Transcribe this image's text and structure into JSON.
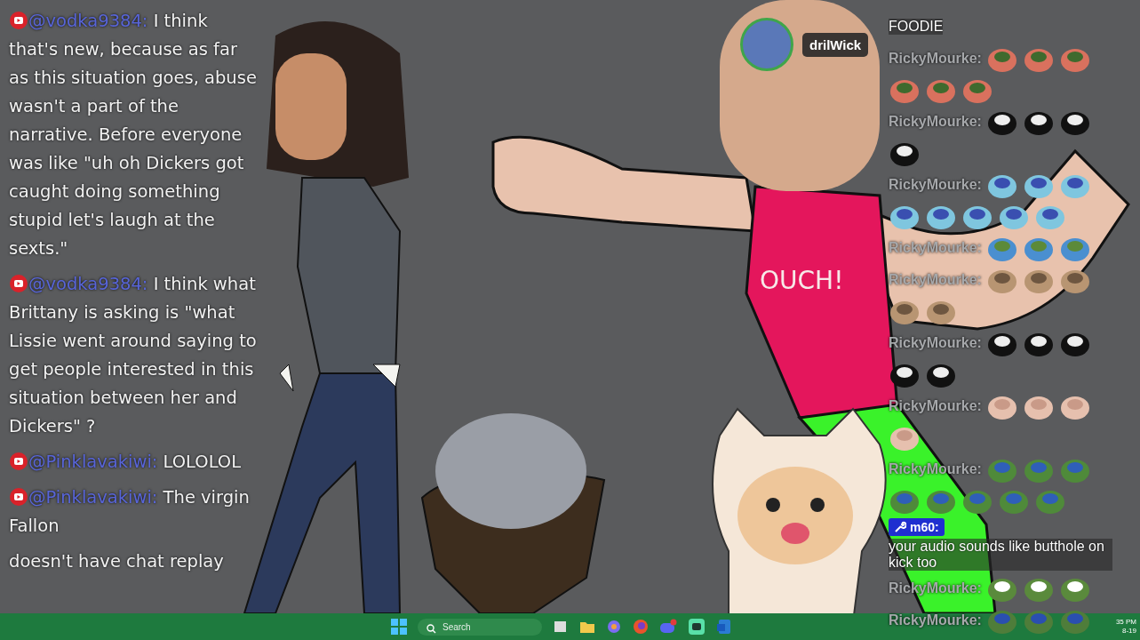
{
  "left_chat": [
    {
      "kind": "message",
      "user": "@vodka9384:",
      "text": "I think that's new, because as far as this situation goes, abuse wasn't a part of the narrative. Before everyone was like \"uh oh Dickers got caught doing something stupid let's laugh at the sexts.\""
    },
    {
      "kind": "message",
      "user": "@vodka9384:",
      "text": "I think what Brittany is asking is \"what Lissie went around saying to get people interested in this situation between her and Dickers\" ?"
    },
    {
      "kind": "message",
      "user": "@Pinklavakiwi:",
      "text": "LOLOLOL"
    },
    {
      "kind": "message",
      "user": "@Pinklavakiwi:",
      "text": "The virgin Fallon"
    },
    {
      "kind": "continuation",
      "text": "doesn't have chat replay"
    }
  ],
  "scene": {
    "shirt_text": "OUCH!",
    "speaker": {
      "name": "drilWick"
    }
  },
  "right_chat": [
    {
      "kind": "continuation",
      "text": "FOODIE"
    },
    {
      "kind": "emotes",
      "user": "RickyMourke:",
      "emotes": [
        {
          "kind": "blanket-frog"
        },
        {
          "kind": "blanket-frog"
        },
        {
          "kind": "blanket-frog"
        },
        {
          "kind": "blanket-frog"
        },
        {
          "kind": "blanket-frog"
        },
        {
          "kind": "blanket-frog"
        }
      ]
    },
    {
      "kind": "emotes",
      "user": "RickyMourke:",
      "emotes": [
        {
          "kind": "cow"
        },
        {
          "kind": "cow"
        },
        {
          "kind": "cow"
        },
        {
          "kind": "cow"
        }
      ]
    },
    {
      "kind": "emotes",
      "user": "RickyMourke:",
      "emotes": [
        {
          "kind": "shout-face"
        },
        {
          "kind": "shout-face"
        },
        {
          "kind": "shout-face"
        },
        {
          "kind": "shout-face"
        },
        {
          "kind": "shout-face"
        },
        {
          "kind": "shout-face"
        },
        {
          "kind": "shout-face"
        },
        {
          "kind": "shout-face"
        }
      ]
    },
    {
      "kind": "emotes",
      "user": "RickyMourke:",
      "emotes": [
        {
          "kind": "wave-frog"
        },
        {
          "kind": "wave-frog"
        },
        {
          "kind": "wave-frog"
        }
      ]
    },
    {
      "kind": "emotes",
      "user": "RickyMourke:",
      "emotes": [
        {
          "kind": "cat"
        },
        {
          "kind": "cat"
        },
        {
          "kind": "cat"
        },
        {
          "kind": "cat"
        },
        {
          "kind": "cat"
        }
      ]
    },
    {
      "kind": "emotes",
      "user": "RickyMourke:",
      "emotes": [
        {
          "kind": "cow"
        },
        {
          "kind": "cow"
        },
        {
          "kind": "cow"
        },
        {
          "kind": "cow"
        },
        {
          "kind": "cow"
        }
      ]
    },
    {
      "kind": "emotes",
      "user": "RickyMourke:",
      "emotes": [
        {
          "kind": "fist"
        },
        {
          "kind": "fist"
        },
        {
          "kind": "fist"
        },
        {
          "kind": "fist"
        }
      ]
    },
    {
      "kind": "emotes",
      "user": "RickyMourke:",
      "emotes": [
        {
          "kind": "dance-frog"
        },
        {
          "kind": "dance-frog"
        },
        {
          "kind": "dance-frog"
        },
        {
          "kind": "dance-frog"
        },
        {
          "kind": "dance-frog"
        },
        {
          "kind": "dance-frog"
        },
        {
          "kind": "dance-frog"
        },
        {
          "kind": "dance-frog"
        }
      ]
    },
    {
      "kind": "badge-message",
      "user": "m60:",
      "text": "your audio sounds like butthole on kick too"
    },
    {
      "kind": "emotes",
      "user": "RickyMourke:",
      "emotes": [
        {
          "kind": "eyes-frog"
        },
        {
          "kind": "eyes-frog"
        },
        {
          "kind": "eyes-frog"
        }
      ]
    },
    {
      "kind": "emotes",
      "user": "RickyMourke:",
      "emotes": [
        {
          "kind": "drive-frog"
        },
        {
          "kind": "drive-frog"
        },
        {
          "kind": "drive-frog"
        }
      ]
    }
  ],
  "taskbar": {
    "search": {
      "placeholder": "Search"
    },
    "time": "35 PM",
    "date": "8-19"
  }
}
